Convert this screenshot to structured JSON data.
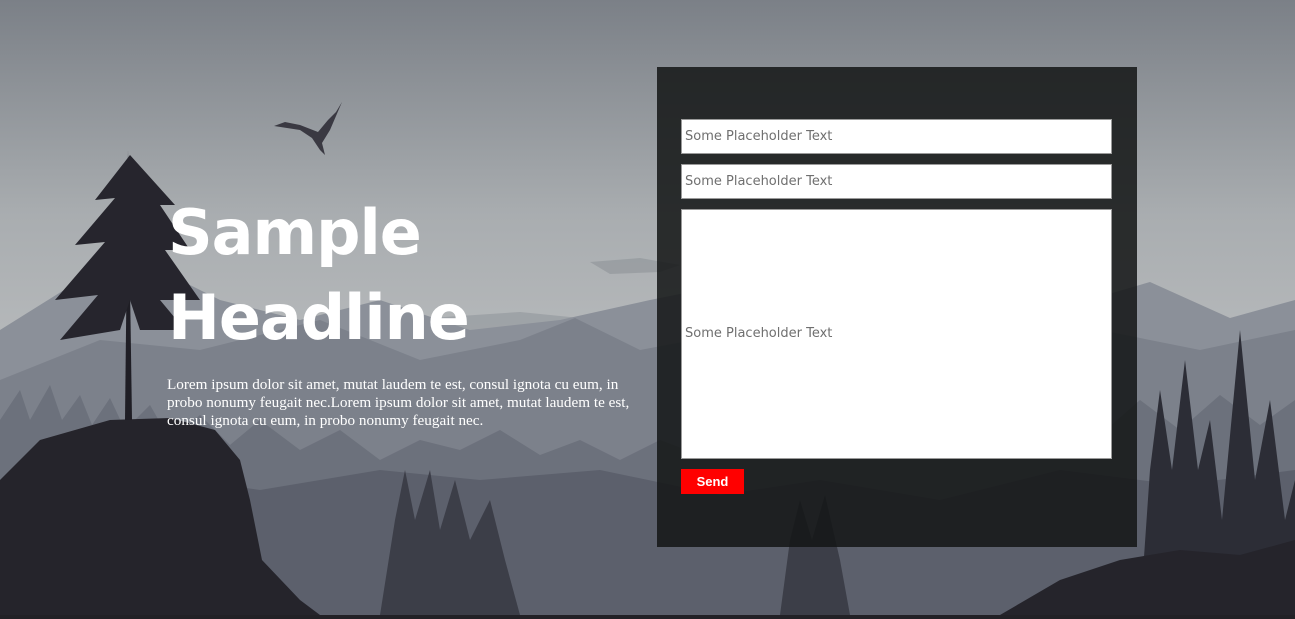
{
  "hero": {
    "headline_line1": "Sample",
    "headline_line2": "Headline",
    "body": "Lorem ipsum dolor sit amet, mutat laudem te est, consul ignota cu eum, in probo nonumy feugait nec.Lorem ipsum dolor sit amet, mutat laudem te est, consul ignota cu eum, in probo nonumy feugait nec."
  },
  "form": {
    "field1_placeholder": "Some Placeholder Text",
    "field2_placeholder": "Some Placeholder Text",
    "message_placeholder": "Some Placeholder Text",
    "send_label": "Send"
  },
  "colors": {
    "accent": "#ff0000",
    "panel": "#141616",
    "sky_top": "#7b8087",
    "sky_mid": "#a9adb0"
  }
}
